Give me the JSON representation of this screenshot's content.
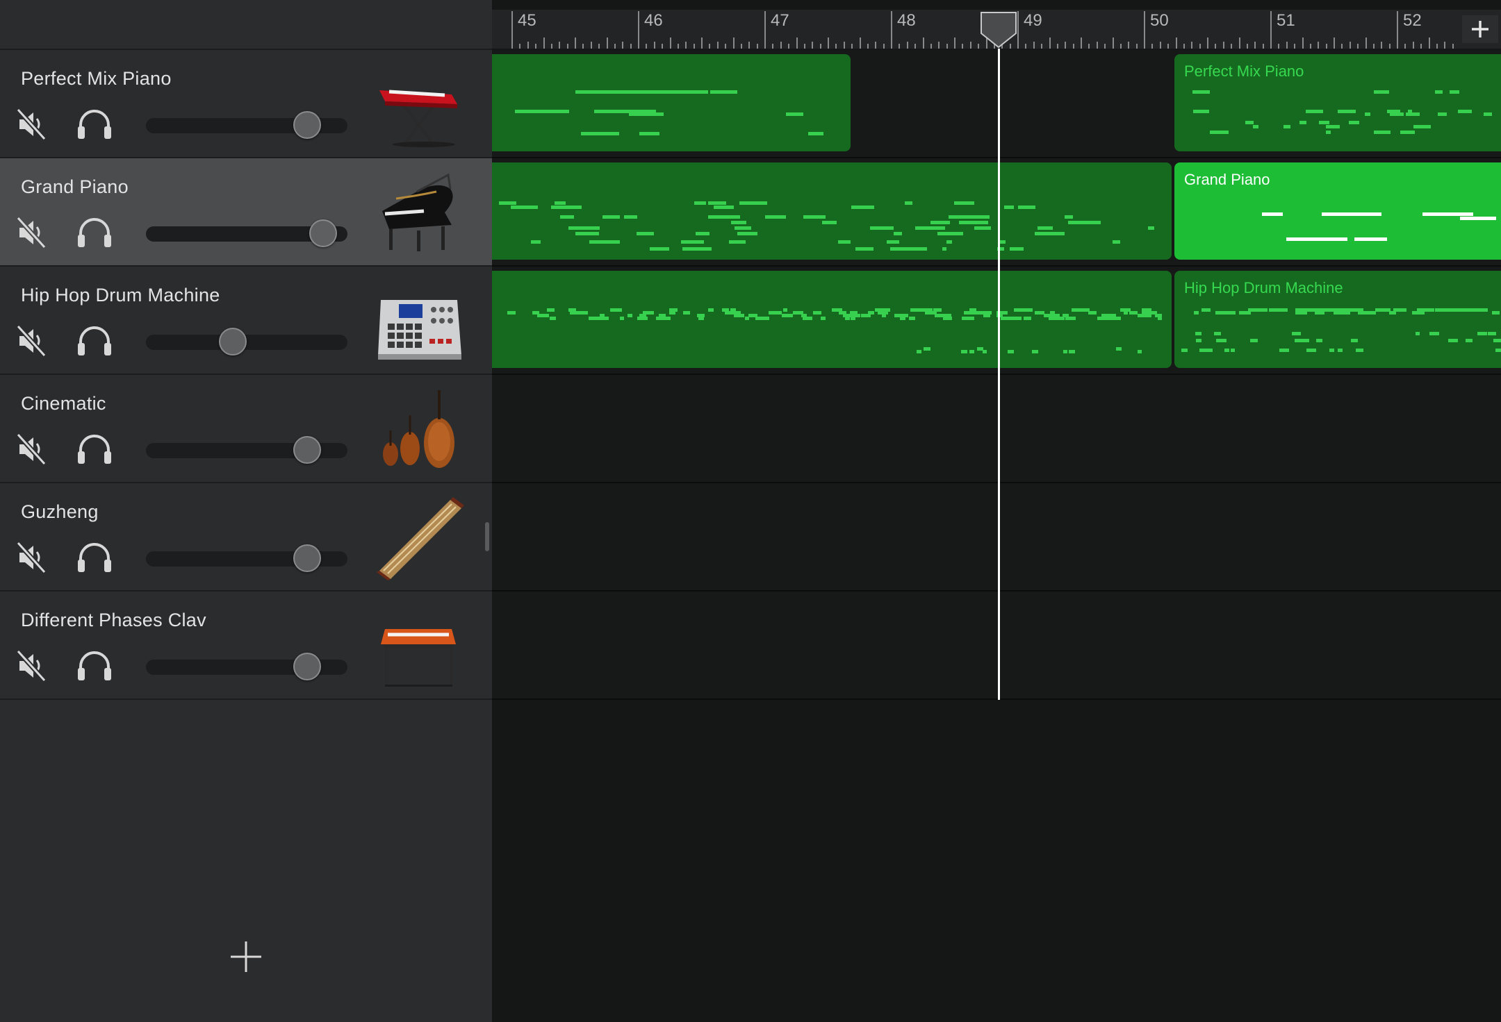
{
  "ruler": {
    "bars": [
      "45",
      "46",
      "47",
      "48",
      "49",
      "50",
      "51",
      "52"
    ],
    "add_label": "+"
  },
  "tracks": [
    {
      "name": "Perfect Mix Piano",
      "volume": 0.8,
      "selected": false,
      "icon": "keyboard-icon",
      "region_label": "Perfect Mix Piano"
    },
    {
      "name": "Grand Piano",
      "volume": 0.88,
      "selected": true,
      "icon": "grand-piano-icon",
      "region_label": "Grand Piano"
    },
    {
      "name": "Hip Hop Drum Machine",
      "volume": 0.43,
      "selected": false,
      "icon": "drum-machine-icon",
      "region_label": "Hip Hop Drum Machine"
    },
    {
      "name": "Cinematic",
      "volume": 0.8,
      "selected": false,
      "icon": "strings-icon"
    },
    {
      "name": "Guzheng",
      "volume": 0.8,
      "selected": false,
      "icon": "guzheng-icon"
    },
    {
      "name": "Different Phases Clav",
      "volume": 0.8,
      "selected": false,
      "icon": "clav-icon"
    }
  ],
  "colors": {
    "region": "#166a20",
    "region_selected": "#1dbd35",
    "note": "#37d14f",
    "background": "#151616",
    "track_header": "#2b2c2e",
    "track_header_selected": "#4b4c4e"
  },
  "add_track_label": "+"
}
